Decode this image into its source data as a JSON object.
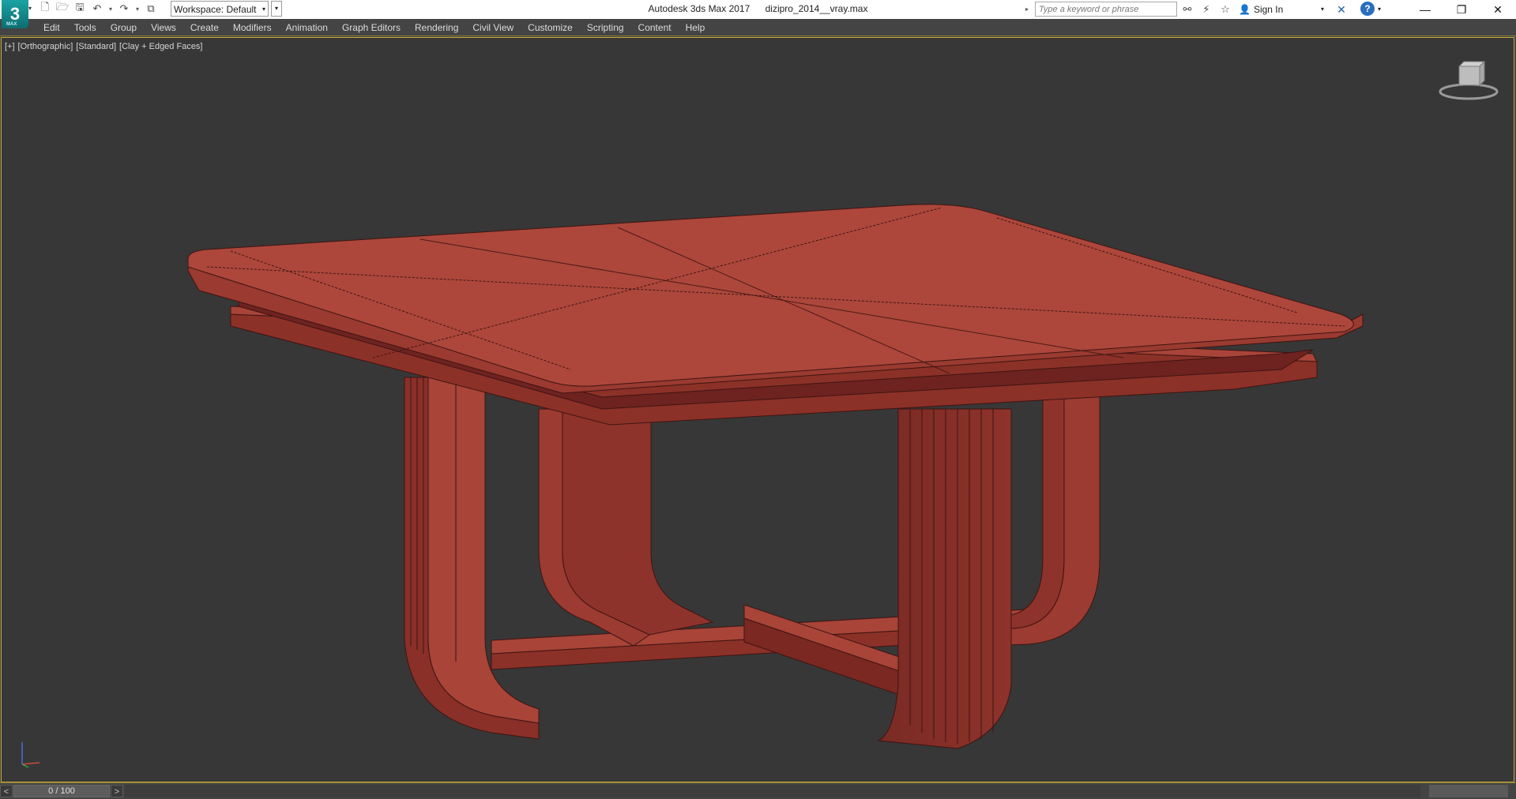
{
  "titlebar": {
    "app_name": "Autodesk 3ds Max 2017",
    "file_name": "dizipro_2014__vray.max",
    "workspace": "Workspace: Default",
    "search_placeholder": "Type a keyword or phrase",
    "sign_in": "Sign In",
    "help": "?",
    "logo_text": "3"
  },
  "menubar": {
    "items": [
      "Edit",
      "Tools",
      "Group",
      "Views",
      "Create",
      "Modifiers",
      "Animation",
      "Graph Editors",
      "Rendering",
      "Civil View",
      "Customize",
      "Scripting",
      "Content",
      "Help"
    ]
  },
  "viewport": {
    "label_plus": "[+]",
    "label_view": "[Orthographic]",
    "label_shading_std": "[Standard]",
    "label_shading": "[Clay + Edged Faces]",
    "object_color": "#a84438",
    "background_color": "#373737"
  },
  "timebar": {
    "frame_display": "0 / 100",
    "prev": "<",
    "next": ">"
  },
  "colors": {
    "menu_bg": "#444444",
    "viewport_border": "#c7a83a",
    "clay_red": "#a84438",
    "clay_dark": "#6e2320"
  }
}
